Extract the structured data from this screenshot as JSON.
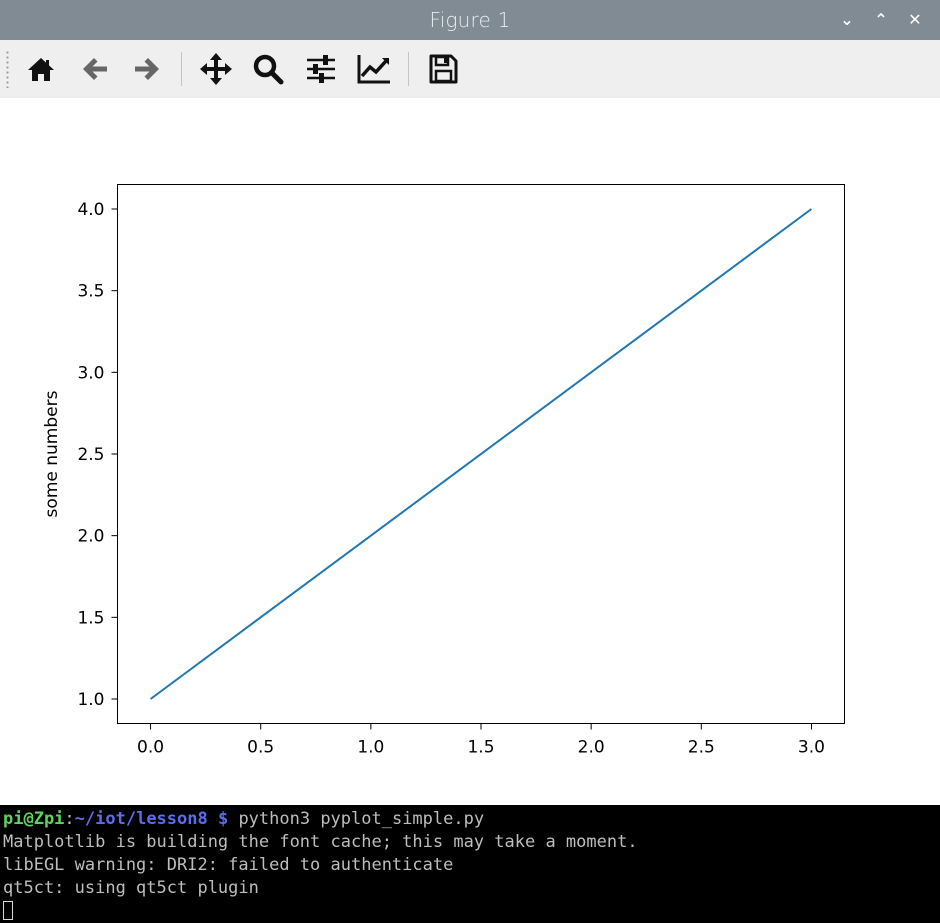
{
  "window": {
    "title": "Figure 1",
    "buttons": {
      "minimize": "⌄",
      "maximize": "⌃",
      "close": "✕"
    }
  },
  "toolbar": {
    "tools": [
      {
        "name": "home",
        "icon": "home-icon"
      },
      {
        "name": "back",
        "icon": "arrow-left-icon"
      },
      {
        "name": "forward",
        "icon": "arrow-right-icon"
      },
      {
        "name": "pan",
        "icon": "move-icon"
      },
      {
        "name": "zoom",
        "icon": "magnifier-icon"
      },
      {
        "name": "subplots",
        "icon": "sliders-icon"
      },
      {
        "name": "edit-axis",
        "icon": "line-chart-icon"
      },
      {
        "name": "save",
        "icon": "floppy-disk-icon"
      }
    ]
  },
  "chart_data": {
    "type": "line",
    "x": [
      0,
      1,
      2,
      3
    ],
    "series": [
      {
        "values": [
          1,
          2,
          3,
          4
        ],
        "color": "#1f77b4"
      }
    ],
    "xlabel": "",
    "ylabel": "some numbers",
    "xlim": [
      -0.15,
      3.15
    ],
    "ylim": [
      0.85,
      4.15
    ],
    "xticks": [
      "0.0",
      "0.5",
      "1.0",
      "1.5",
      "2.0",
      "2.5",
      "3.0"
    ],
    "yticks": [
      "1.0",
      "1.5",
      "2.0",
      "2.5",
      "3.0",
      "3.5",
      "4.0"
    ],
    "grid": false
  },
  "terminal": {
    "prompt_user": "pi@Zpi",
    "prompt_sep": ":",
    "prompt_path": "~/iot/lesson8 $",
    "command": " python3 pyplot_simple.py",
    "lines": [
      "Matplotlib is building the font cache; this may take a moment.",
      "libEGL warning: DRI2: failed to authenticate",
      "qt5ct: using qt5ct plugin"
    ]
  }
}
